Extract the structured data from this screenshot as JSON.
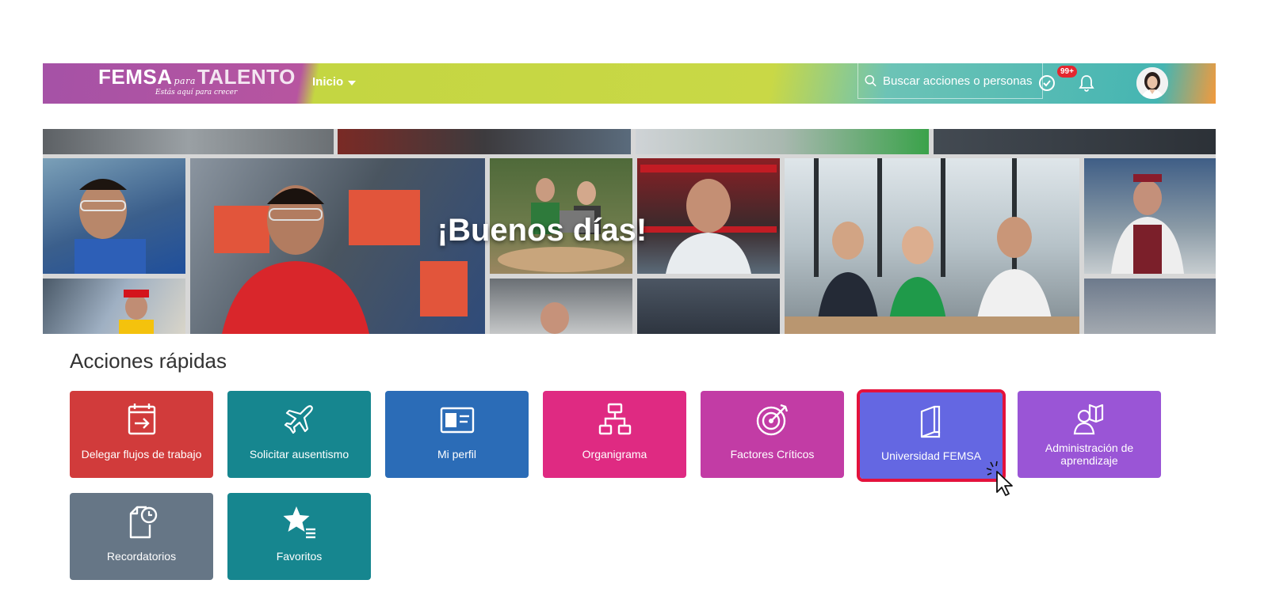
{
  "header": {
    "logo_text": "FEMSA",
    "logo_word": "TALENTO",
    "logo_tag": "para",
    "logo_subtitle": "Estás aquí para crecer",
    "nav_label": "Inicio",
    "search_placeholder": "Buscar acciones o personas",
    "notifications_badge": "99+",
    "colors": {
      "purple": "#b04fa3",
      "lime": "#c9d846",
      "teal": "#45b5b2",
      "orange": "#f39a3c"
    }
  },
  "banner": {
    "greeting": "¡Buenos días!"
  },
  "quick_actions": {
    "title": "Acciones rápidas",
    "tiles": [
      {
        "label": "Delegar flujos de trabajo",
        "icon": "calendar-arrow-icon",
        "color": "#d13b3b"
      },
      {
        "label": "Solicitar ausentismo",
        "icon": "airplane-icon",
        "color": "#16868f"
      },
      {
        "label": "Mi perfil",
        "icon": "id-card-icon",
        "color": "#2b6cb7"
      },
      {
        "label": "Organigrama",
        "icon": "org-chart-icon",
        "color": "#df2a82"
      },
      {
        "label": "Factores Críticos",
        "icon": "target-icon",
        "color": "#c23ca5"
      },
      {
        "label": "Universidad FEMSA",
        "icon": "book-icon",
        "color": "#6467e2",
        "selected": true
      },
      {
        "label": "Administración de aprendizaje",
        "icon": "person-book-icon",
        "color": "#9a55d6"
      },
      {
        "label": "Recordatorios",
        "icon": "document-clock-icon",
        "color": "#667686"
      },
      {
        "label": "Favoritos",
        "icon": "star-list-icon",
        "color": "#16868f"
      }
    ]
  }
}
